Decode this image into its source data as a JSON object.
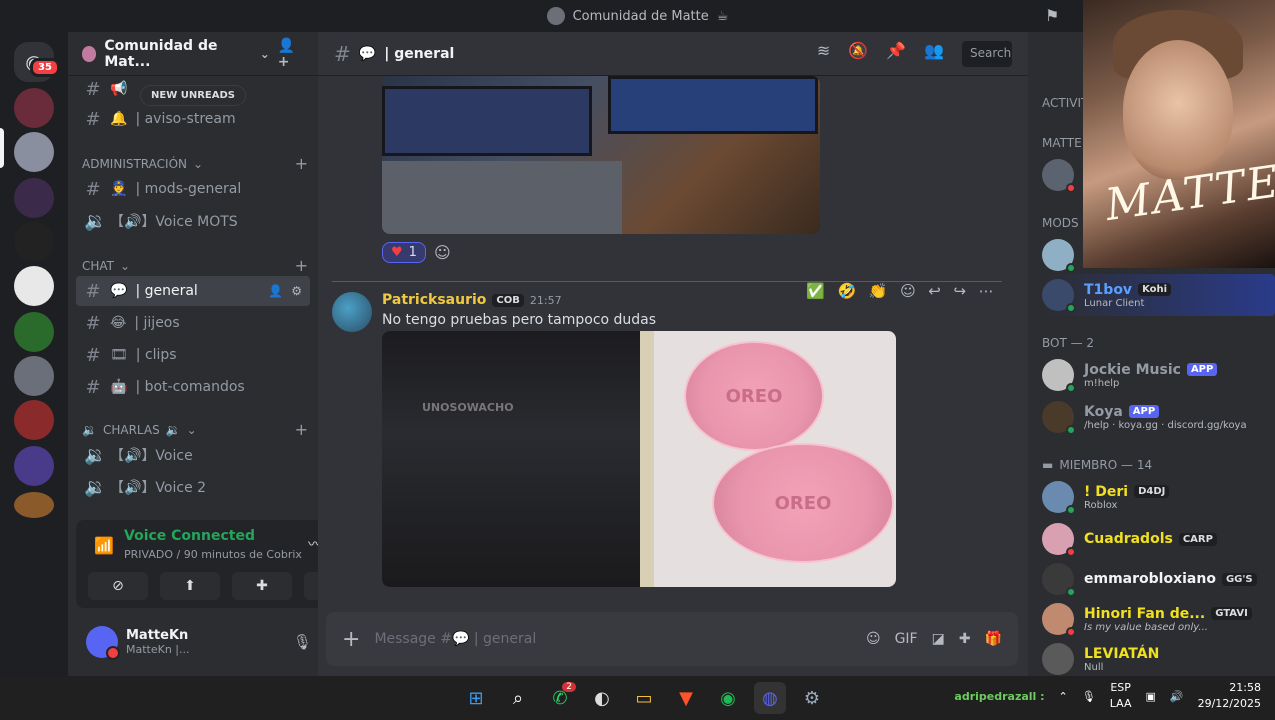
{
  "window": {
    "title": "Comunidad de Matte"
  },
  "rail": {
    "badge": "35"
  },
  "guild": {
    "name": "Comunidad de Mat..."
  },
  "sidebar": {
    "new_unreads": "NEW UNREADS",
    "channels_top": [
      {
        "label": "| aviso-stream"
      }
    ],
    "cat_admin": "ADMINISTRACIÓN",
    "admin_channels": [
      {
        "label": "| mods-general"
      },
      {
        "label": "【🔊】Voice MOTS"
      }
    ],
    "cat_chat": "CHAT",
    "chat_channels": [
      {
        "label": "| general"
      },
      {
        "label": "| jijeos"
      },
      {
        "label": "| clips"
      },
      {
        "label": "| bot-comandos"
      }
    ],
    "cat_charlas": "CHARLAS",
    "voice_channels": [
      {
        "label": "【🔊】Voice"
      },
      {
        "label": "【🔊】Voice 2"
      }
    ]
  },
  "voice": {
    "status": "Voice Connected",
    "sub": "PRIVADO / 90 minutos de Cobrix"
  },
  "user": {
    "name": "MatteKn",
    "tag": "MatteKn |..."
  },
  "chat": {
    "channel": "| general",
    "search_placeholder": "Search",
    "reaction_count": "1",
    "message": {
      "author": "Patricksaurio",
      "tag": "COB",
      "time": "21:57",
      "text": "No tengo pruebas pero tampoco dudas",
      "watermark": "UNOSOWACHO",
      "cookie_text": "OREO"
    },
    "composer_placeholder": "Message #💬 | general"
  },
  "members": {
    "activity": "Activity",
    "cat_matte": "MATTE",
    "cat_mods": "MODS",
    "cat_bot": "BOT — 2",
    "cat_miembro": "MIEMBRO — 14",
    "featured": {
      "name": "T1bov",
      "tag": "Kohi",
      "sub": "Lunar Client"
    },
    "bots": [
      {
        "name": "Jockie Music",
        "badge": "APP",
        "sub": "m!help",
        "color": "#949ba4"
      },
      {
        "name": "Koya",
        "badge": "APP",
        "sub": "/help · koya.gg · discord.gg/koya",
        "color": "#949ba4"
      }
    ],
    "list": [
      {
        "name": "! Deri",
        "tag": "D4DJ",
        "sub": "Roblox",
        "color": "#f0e020"
      },
      {
        "name": "Cuadradols",
        "tag": "CARP",
        "sub": "",
        "color": "#f0e020"
      },
      {
        "name": "emmarobloxiano",
        "tag": "GG'S",
        "sub": "",
        "color": "#f2f3f5"
      },
      {
        "name": "Hinori Fan de...",
        "tag": "GTAVI",
        "sub": "Is my value based only...",
        "color": "#f0e020"
      },
      {
        "name": "LEVIATÁN",
        "tag": "",
        "sub": "Null",
        "color": "#f0e020"
      }
    ]
  },
  "webcam": {
    "signature": "MATTE"
  },
  "taskbar": {
    "user": "adripedrazall :",
    "whatsapp_badge": "2",
    "lang1": "ESP",
    "lang2": "LAA",
    "time": "21:58",
    "date": "29/12/2025"
  },
  "colors": {
    "accent": "#5865f2",
    "online": "#23a55a",
    "dnd": "#f23f43"
  }
}
